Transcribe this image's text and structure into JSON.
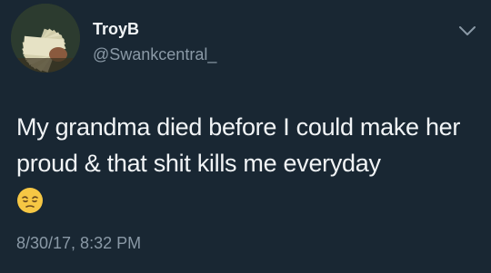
{
  "tweet": {
    "display_name": "TroyB",
    "handle": "@Swankcentral_",
    "text": "My grandma died before I could make her proud & that shit kills me everyday",
    "emoji": "pensive-face",
    "timestamp": "8/30/17, 8:32 PM"
  },
  "icons": {
    "menu": "chevron-down-icon"
  },
  "colors": {
    "background": "#192733",
    "text_primary": "#f1f4f6",
    "text_secondary": "#8a99a6",
    "emoji_face": "#f6c744"
  }
}
